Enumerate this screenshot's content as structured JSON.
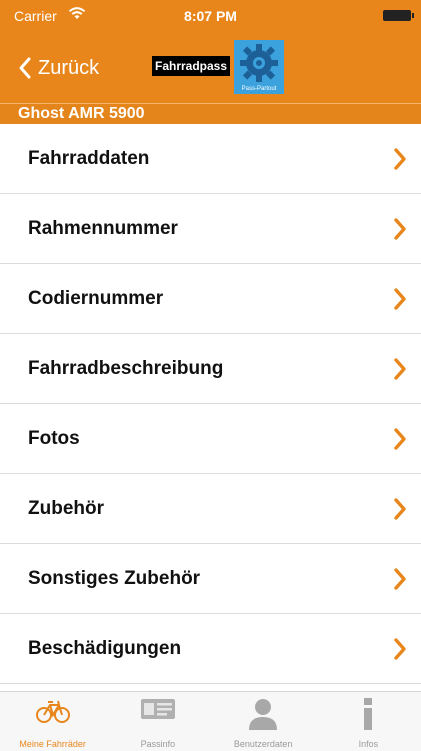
{
  "status_bar": {
    "carrier": "Carrier",
    "time": "8:07 PM"
  },
  "nav": {
    "back_label": "Zurück",
    "logo_text": "Fahrradpass",
    "logo_sub": "Pass-Partout"
  },
  "section_title": "Ghost AMR 5900",
  "menu_items": [
    "Fahrraddaten",
    "Rahmennummer",
    "Codiernummer",
    "Fahrradbeschreibung",
    "Fotos",
    "Zubehör",
    "Sonstiges Zubehör",
    "Beschädigungen"
  ],
  "tabs": [
    {
      "label": "Meine Fahrräder",
      "icon": "bicycle-icon",
      "active": true
    },
    {
      "label": "Passinfo",
      "icon": "passinfo-icon",
      "active": false
    },
    {
      "label": "Benutzerdaten",
      "icon": "user-icon",
      "active": false
    },
    {
      "label": "Infos",
      "icon": "info-icon",
      "active": false
    }
  ],
  "colors": {
    "accent": "#e8861c",
    "badge_blue": "#3ca2de",
    "inactive": "#9a9a9a"
  }
}
